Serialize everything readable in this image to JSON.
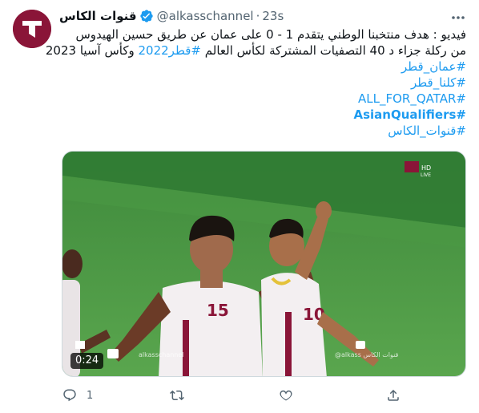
{
  "author": {
    "display_name": "قنوات الكاس",
    "handle": "@alkasschannel",
    "separator": "·",
    "time": "23s",
    "verified": true
  },
  "tweet": {
    "line1": "فيديو : هدف منتخبنا الوطني يتقدم 1 - 0 على عمان عن طريق حسين الهيدوس",
    "line2_text": "من ركلة جزاء د 40  التصفيات المشتركة لكأس العالم ",
    "line2_tag": "#قطر2022",
    "line2_tail": " وكأس آسيا 2023",
    "hashtags": [
      "#عمان_قطر",
      "#كلنا_قطر",
      "#ALL_FOR_QATAR",
      "#AsianQualifiers",
      "#قنوات_الكاس"
    ]
  },
  "video": {
    "duration": "0:24",
    "broadcast_badge": "HD",
    "live_badge": "LIVE",
    "watermark_left": "alkasschannel",
    "watermark_right": "@alkass قنوات الكاس",
    "player1_number": "15",
    "player2_number": "10"
  },
  "actions": {
    "reply_count": "1",
    "retweet_count": "",
    "like_count": ""
  },
  "icons": {
    "avatar": "alkass-logo",
    "verified": "verified-badge-icon",
    "more": "more-icon",
    "reply": "reply-icon",
    "retweet": "retweet-icon",
    "like": "heart-icon",
    "share": "share-icon"
  },
  "colors": {
    "link": "#1d9bf0",
    "brand": "#8a1538",
    "muted": "#536471"
  }
}
